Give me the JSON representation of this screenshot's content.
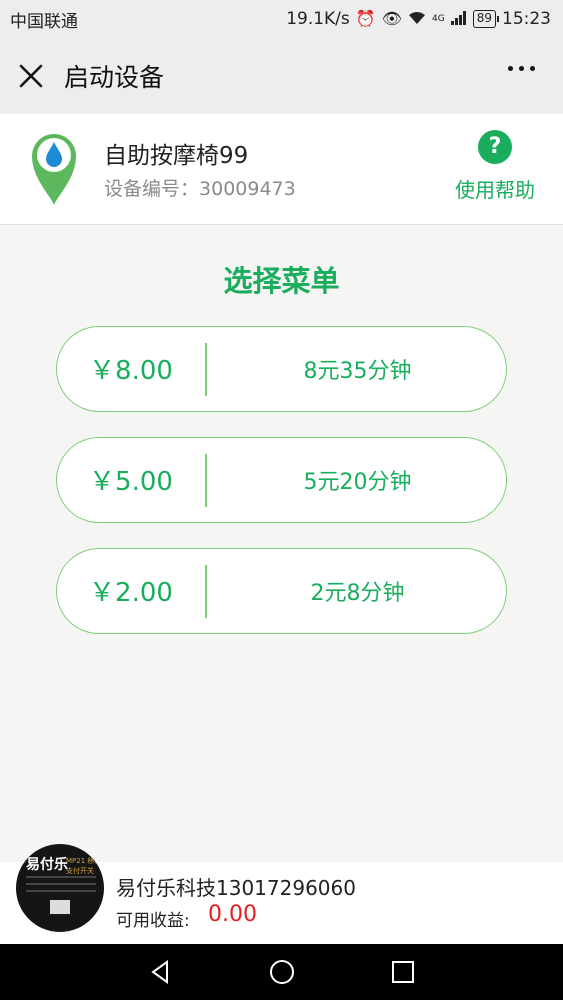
{
  "status_bar": {
    "carrier": "中国联通",
    "speed": "19.1K/s",
    "network": "4G",
    "battery": "89",
    "time": "15:23"
  },
  "nav": {
    "title": "启动设备",
    "close_icon": "close-icon",
    "more_icon": "more-dots-icon"
  },
  "device": {
    "name": "自助按摩椅99",
    "id_label": "设备编号：",
    "id_value": "30009473",
    "icon": "location-drop-icon",
    "help_symbol": "?",
    "help_label": "使用帮助"
  },
  "menu": {
    "title": "选择菜单",
    "options": [
      {
        "price": "￥8.00",
        "desc": "8元35分钟"
      },
      {
        "price": "￥5.00",
        "desc": "5元20分钟"
      },
      {
        "price": "￥2.00",
        "desc": "2元8分钟"
      }
    ]
  },
  "footer": {
    "avatar_title": "易付乐",
    "avatar_tag": "MP21 移动支付开关",
    "merchant_name": "易付乐科技13017296060",
    "balance_label": "可用收益:",
    "balance_value": "0.00"
  },
  "colors": {
    "accent": "#1aad5d",
    "border": "#7fce79",
    "balance": "#e02020"
  }
}
